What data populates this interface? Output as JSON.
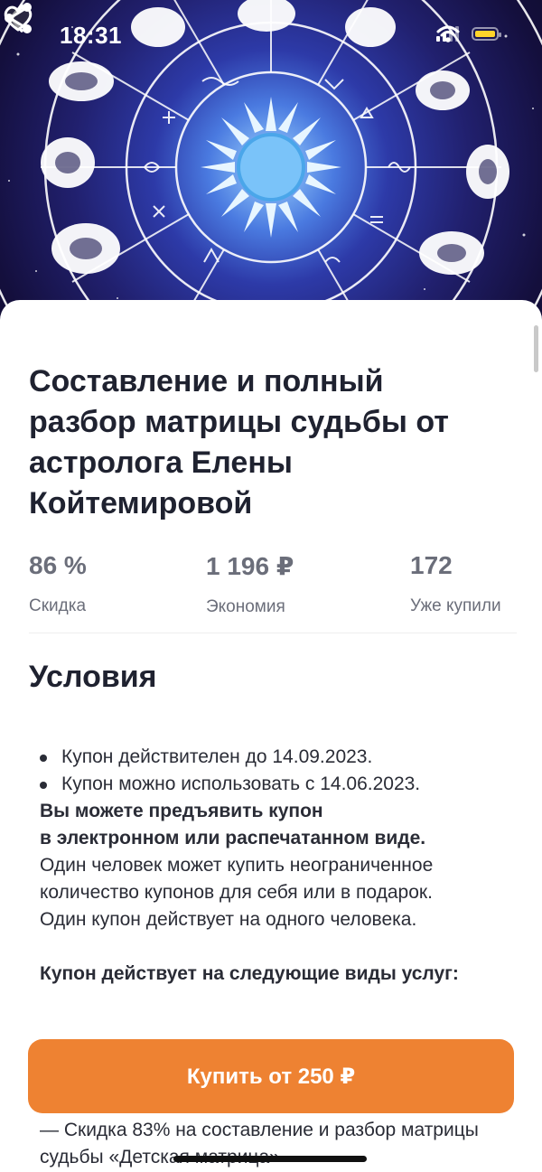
{
  "status_bar": {
    "time": "18:31"
  },
  "offer": {
    "title": "Составление и полный разбор матрицы судьбы от астролога Елены Койтемировой",
    "stats": [
      {
        "value": "86 %",
        "label": "Скидка"
      },
      {
        "value": "1 196 ₽",
        "label": "Экономия"
      },
      {
        "value": "172",
        "label": "Уже купили"
      }
    ]
  },
  "conditions": {
    "heading": "Условия",
    "bullets": [
      "Купон действителен до 14.09.2023.",
      "Купон можно использовать с 14.06.2023."
    ],
    "bold_line_1": "Вы можете предъявить купон",
    "bold_line_2": "в электронном или распечатанном виде.",
    "text_1": "Один человек может купить неограниченное количество купонов для себя или в подарок.",
    "text_2": "Один купон действует на одного человека.",
    "services_title": "Купон действует на следующие виды услуг:",
    "service_item": "— Скидка 83% на составление и разбор матрицы судьбы «Детская матрица»"
  },
  "buy_button": {
    "label": "Купить от 250 ₽"
  },
  "colors": {
    "accent": "#ee8232",
    "battery": "#ffd42a",
    "hero_center": "#9fd6ff"
  },
  "icons": [
    "back-icon",
    "heart-icon",
    "share-icon",
    "wifi-icon",
    "signal-icon",
    "battery-icon"
  ]
}
